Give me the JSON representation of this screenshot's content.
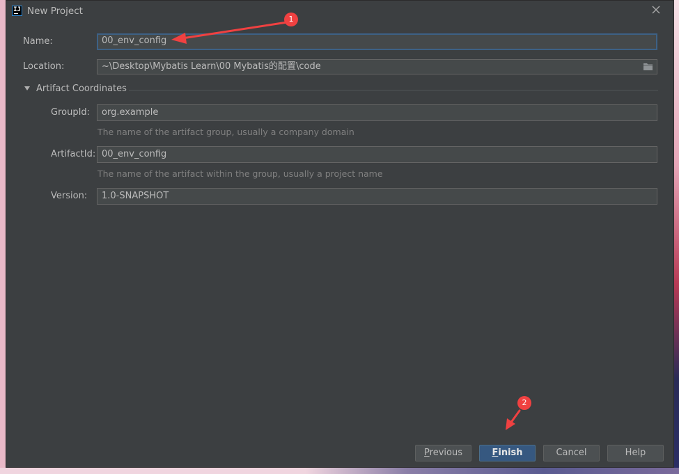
{
  "window": {
    "title": "New Project"
  },
  "form": {
    "name_label": "Name:",
    "name_value": "00_env_config",
    "location_label": "Location:",
    "location_value": "~\\Desktop\\Mybatis Learn\\00 Mybatis的配置\\code"
  },
  "artifact": {
    "section_label": "Artifact Coordinates",
    "group_label": "GroupId:",
    "group_value": "org.example",
    "group_hint": "The name of the artifact group, usually a company domain",
    "artifact_label": "ArtifactId:",
    "artifact_value": "00_env_config",
    "artifact_hint": "The name of the artifact within the group, usually a project name",
    "version_label": "Version:",
    "version_value": "1.0-SNAPSHOT"
  },
  "buttons": {
    "previous_first": "P",
    "previous_rest": "revious",
    "finish_first": "F",
    "finish_rest": "inish",
    "cancel": "Cancel",
    "help": "Help"
  },
  "annotations": {
    "marker_1": "1",
    "marker_2": "2"
  },
  "icons": {
    "app": "intellij-idea-icon",
    "close": "close-icon",
    "folder": "folder-icon",
    "expand": "triangle-down-icon"
  },
  "colors": {
    "dialog_bg": "#3c3f41",
    "field_bg": "#45494a",
    "focus_border": "#3d6185",
    "primary_button": "#365880",
    "annotation_red": "#f04141"
  }
}
